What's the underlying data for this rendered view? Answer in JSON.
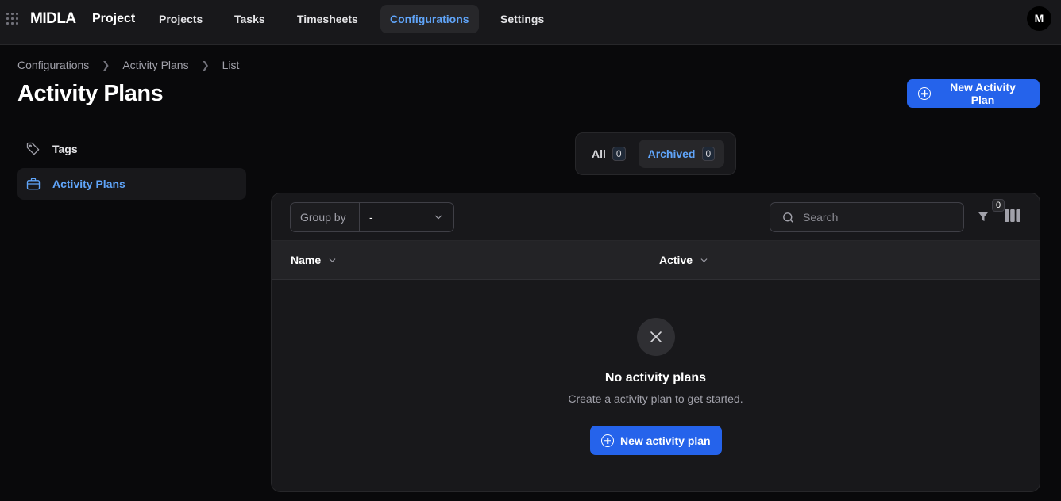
{
  "header": {
    "brand": "MIDLA",
    "app_name": "Project",
    "nav": [
      {
        "label": "Projects"
      },
      {
        "label": "Tasks"
      },
      {
        "label": "Timesheets"
      },
      {
        "label": "Configurations",
        "active": true
      },
      {
        "label": "Settings"
      }
    ],
    "avatar_initial": "M"
  },
  "breadcrumb": [
    "Configurations",
    "Activity Plans",
    "List"
  ],
  "page": {
    "title": "Activity Plans",
    "new_button_label": "New Activity Plan"
  },
  "sidebar": {
    "items": [
      {
        "label": "Tags",
        "icon": "tag-icon"
      },
      {
        "label": "Activity Plans",
        "icon": "briefcase-icon",
        "active": true
      }
    ]
  },
  "tabs": [
    {
      "label": "All",
      "count": "0"
    },
    {
      "label": "Archived",
      "count": "0",
      "active": true
    }
  ],
  "table": {
    "group_by_label": "Group by",
    "group_by_value": "-",
    "search_placeholder": "Search",
    "filter_count": "0",
    "columns": [
      "Name",
      "Active"
    ],
    "empty": {
      "title": "No activity plans",
      "description": "Create a activity plan to get started.",
      "button_label": "New activity plan"
    }
  },
  "colors": {
    "accent": "#2563eb",
    "active_text": "#60a5fa",
    "background": "#09090b"
  }
}
